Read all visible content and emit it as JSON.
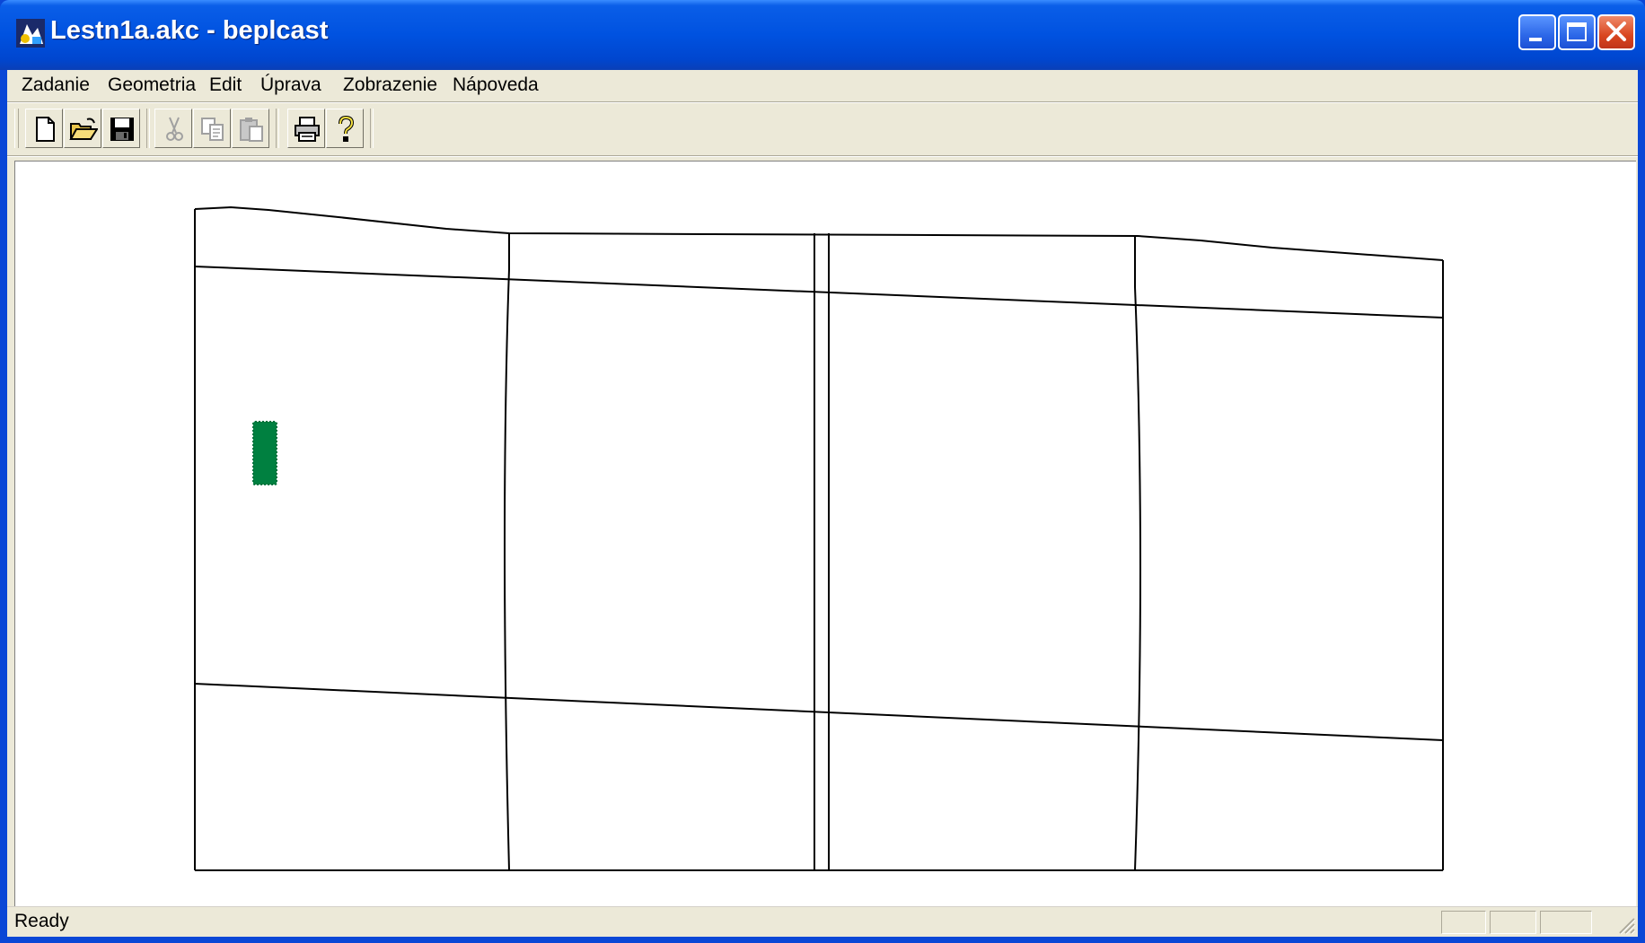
{
  "window": {
    "title": "Lestn1a.akc - beplcast",
    "app_icon": "beplcast-app-icon",
    "controls": [
      "minimize-icon",
      "maximize-icon",
      "close-icon"
    ]
  },
  "menu": {
    "items": [
      "Zadanie",
      "Geometria",
      "Edit",
      "Úprava",
      "Zobrazenie",
      "Nápoveda"
    ]
  },
  "toolbar": {
    "buttons": [
      {
        "name": "new-button",
        "icon": "new-document-icon",
        "enabled": true
      },
      {
        "name": "open-button",
        "icon": "open-folder-icon",
        "enabled": true
      },
      {
        "name": "save-button",
        "icon": "save-disk-icon",
        "enabled": true
      },
      {
        "name": "cut-button",
        "icon": "scissors-icon",
        "enabled": false
      },
      {
        "name": "copy-button",
        "icon": "copy-icon",
        "enabled": false
      },
      {
        "name": "paste-button",
        "icon": "paste-icon",
        "enabled": false
      },
      {
        "name": "print-button",
        "icon": "printer-icon",
        "enabled": true
      },
      {
        "name": "help-button",
        "icon": "help-question-icon",
        "enabled": true
      }
    ]
  },
  "drawing": {
    "line_color": "#000000",
    "marker_color": "#008040"
  },
  "status": {
    "text": "Ready"
  }
}
